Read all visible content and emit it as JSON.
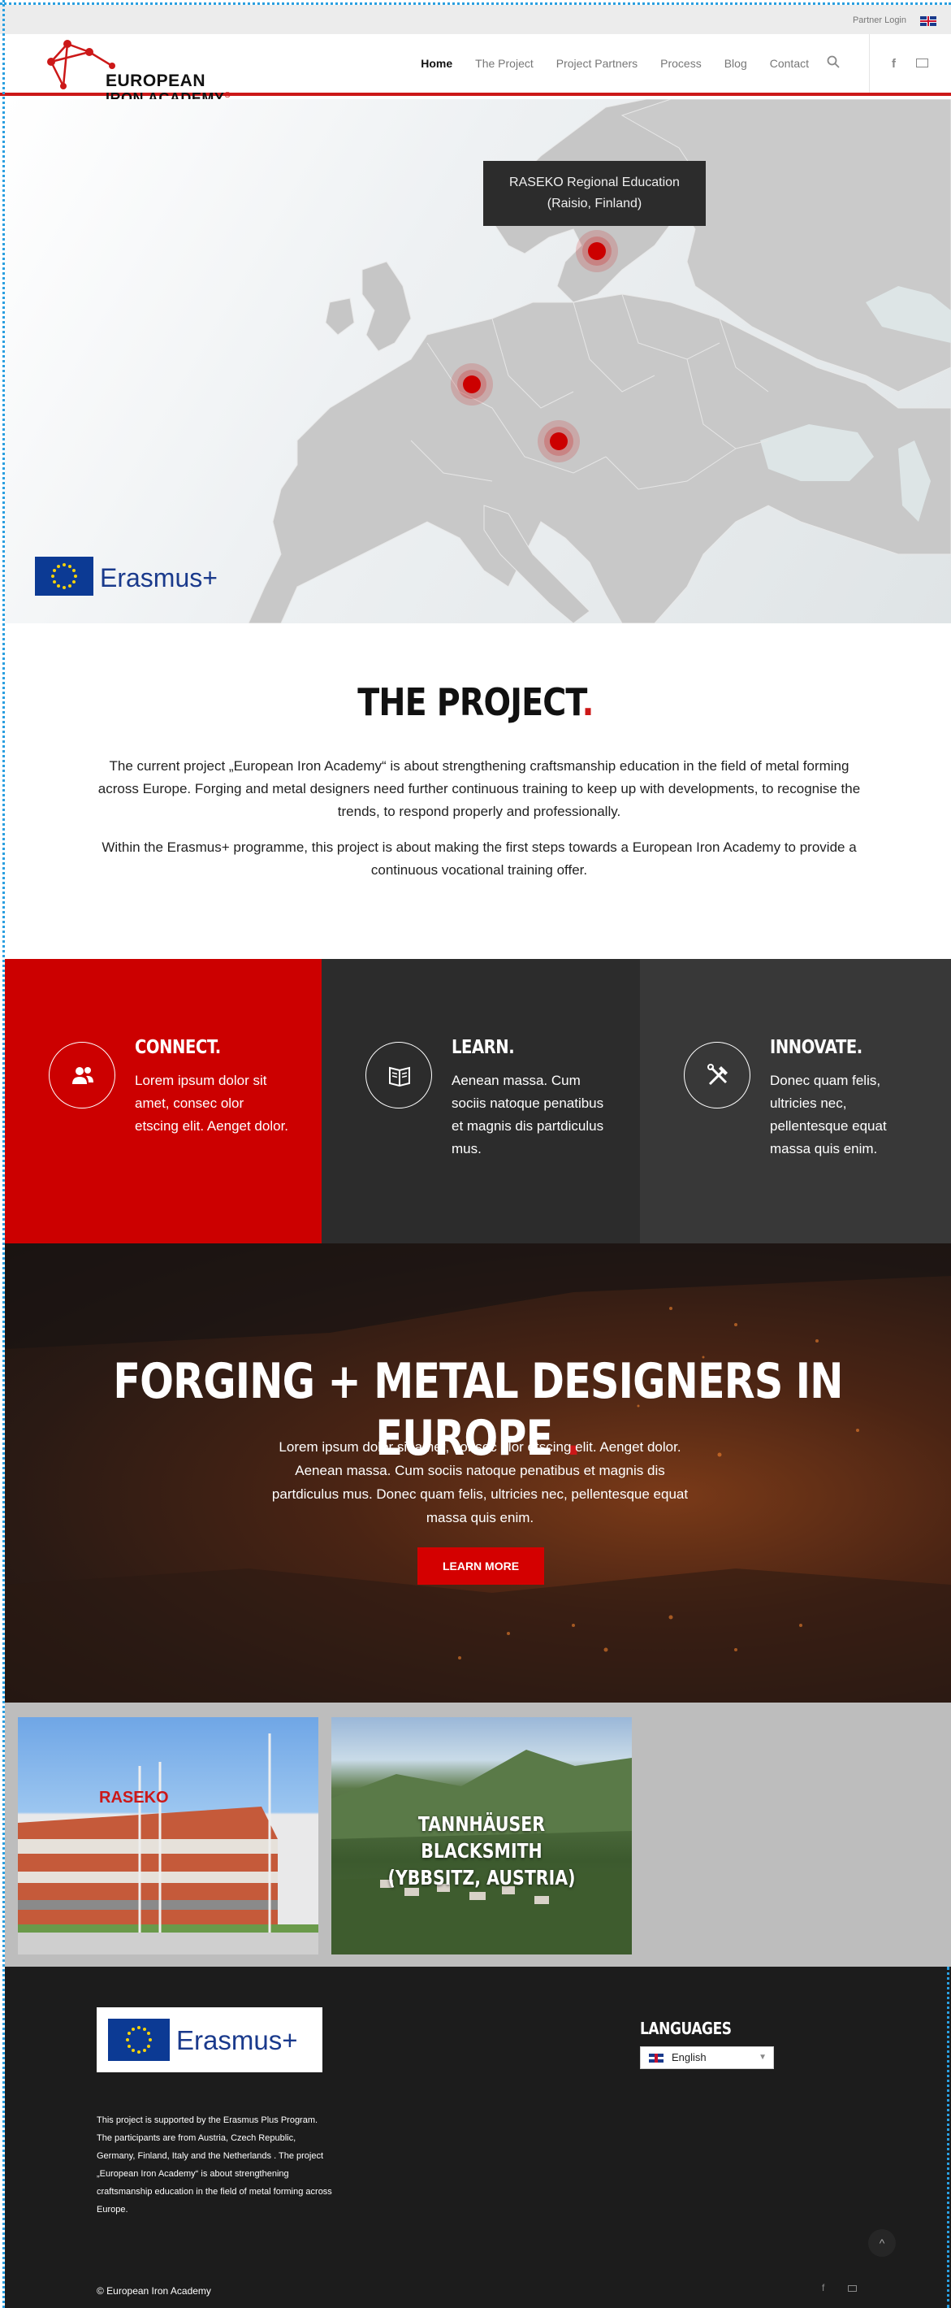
{
  "topbar": {
    "partner_login": "Partner Login",
    "language_flag": "uk-flag-icon"
  },
  "header": {
    "logo_line1": "EUROPEAN",
    "logo_line2": "IRON ACADEMY",
    "logo_mark": "®",
    "nav": [
      "Home",
      "The Project",
      "Project Partners",
      "Process",
      "Blog",
      "Contact"
    ],
    "active_nav": "Home",
    "search_icon": "search-icon",
    "social": [
      "facebook-icon",
      "mail-icon"
    ]
  },
  "hero": {
    "tooltip_line1": "RASEKO Regional Education",
    "tooltip_line2": "(Raisio, Finland)",
    "erasmus_label": "Erasmus+",
    "colors": {
      "accent": "#cc1818",
      "map_land": "#c9c9c9"
    }
  },
  "project": {
    "title": "THE PROJECT",
    "title_dot": ".",
    "paragraph1": "The current project „European Iron Academy“ is about strengthening craftsmanship education in the field of metal forming across Europe. Forging and metal designers need further continuous training to keep up with developments, to recognise the trends, to respond properly and professionally.",
    "paragraph2": "Within the Erasmus+ programme, this project is about making the first steps towards a European Iron Academy to provide a continuous vocational training offer."
  },
  "features": [
    {
      "title": "CONNECT.",
      "text": "Lorem ipsum dolor sit amet, consec olor etscing elit. Aenget dolor.",
      "icon": "users-icon"
    },
    {
      "title": "LEARN.",
      "text": "Aenean massa. Cum sociis natoque penatibus et magnis dis partdiculus mus.",
      "icon": "book-icon"
    },
    {
      "title": "INNOVATE.",
      "text": "Donec quam felis, ultricies nec, pellentesque equat massa quis enim.",
      "icon": "tools-icon"
    }
  ],
  "forging": {
    "title": "FORGING + METAL DESIGNERS IN EUROPE",
    "title_dot": ".",
    "text": "Lorem ipsum dolor sit amet, consec olor etscing elit. Aenget dolor. Aenean massa. Cum sociis natoque penatibus et magnis dis partdiculus mus. Donec quam felis, ultricies nec, pellentesque equat massa quis enim.",
    "button": "LEARN MORE"
  },
  "partners": {
    "tile1_sign": "RASEKO",
    "tile2_label_line1": "TANNHÄUSER BLACKSMITH",
    "tile2_label_line2": "(YBBSITZ, AUSTRIA)"
  },
  "footer": {
    "erasmus_label": "Erasmus+",
    "about": "This project is supported by the Erasmus Plus Program. The participants are from Austria, Czech Republic, Germany, Finland, Italy and the Netherlands . The project „European Iron Academy“ is about strengthening craftsmanship education in the field of metal forming across Europe.",
    "languages_title": "LANGUAGES",
    "language_selected": "English",
    "copyright": "© European Iron Academy",
    "to_top": "^",
    "social": [
      "facebook-icon",
      "mail-icon"
    ]
  }
}
